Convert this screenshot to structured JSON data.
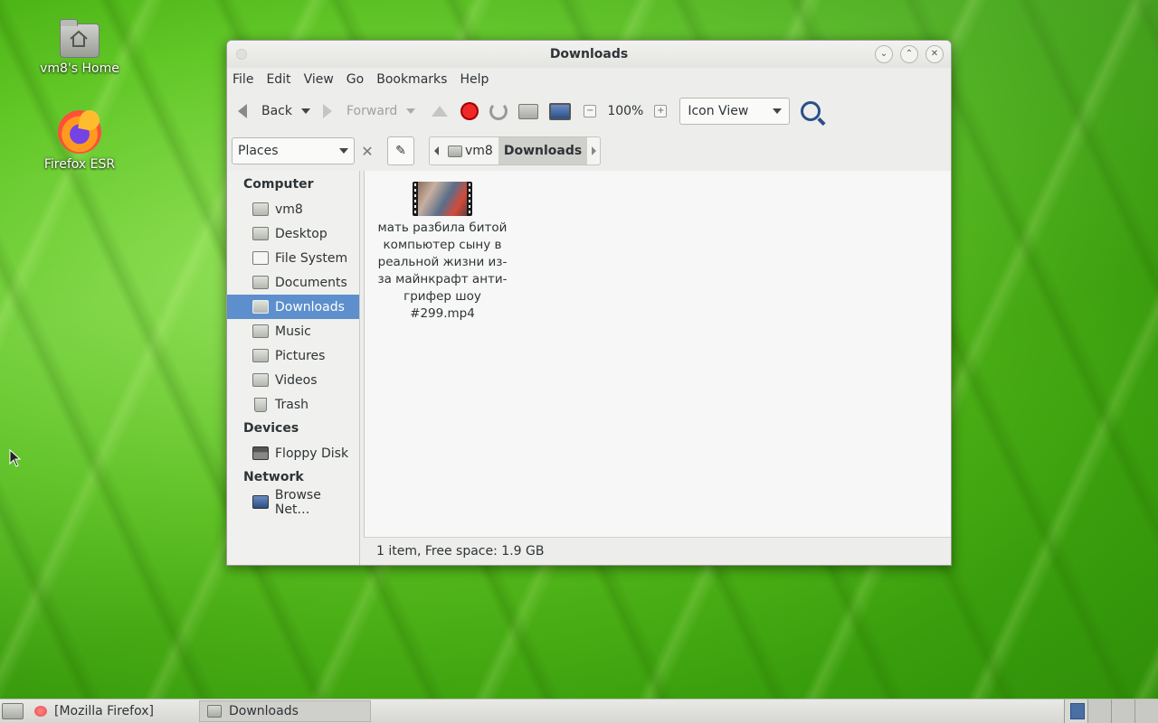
{
  "desktop": {
    "icons": [
      {
        "label": "vm8's Home",
        "icon": "home-folder-icon"
      },
      {
        "label": "Firefox ESR",
        "icon": "firefox-icon"
      }
    ]
  },
  "window": {
    "title": "Downloads",
    "menu": [
      "File",
      "Edit",
      "View",
      "Go",
      "Bookmarks",
      "Help"
    ],
    "toolbar": {
      "back": "Back",
      "forward": "Forward",
      "zoom": "100%",
      "view_mode": "Icon View"
    },
    "location": {
      "side_pane_select": "Places",
      "crumbs": [
        "vm8",
        "Downloads"
      ]
    },
    "sidebar": {
      "computer_header": "Computer",
      "computer_items": [
        "vm8",
        "Desktop",
        "File System",
        "Documents",
        "Downloads",
        "Music",
        "Pictures",
        "Videos",
        "Trash"
      ],
      "devices_header": "Devices",
      "devices_items": [
        "Floppy Disk"
      ],
      "network_header": "Network",
      "network_items": [
        "Browse Net…"
      ],
      "selected": "Downloads"
    },
    "files": [
      {
        "name": "мать разбила битой компьютер сыну в реальной жизни из-за майнкрафт анти-грифер шоу #299.mp4"
      }
    ],
    "status": "1 item, Free space: 1.9 GB"
  },
  "taskbar": {
    "tasks": [
      "[Mozilla Firefox]",
      "Downloads"
    ]
  }
}
